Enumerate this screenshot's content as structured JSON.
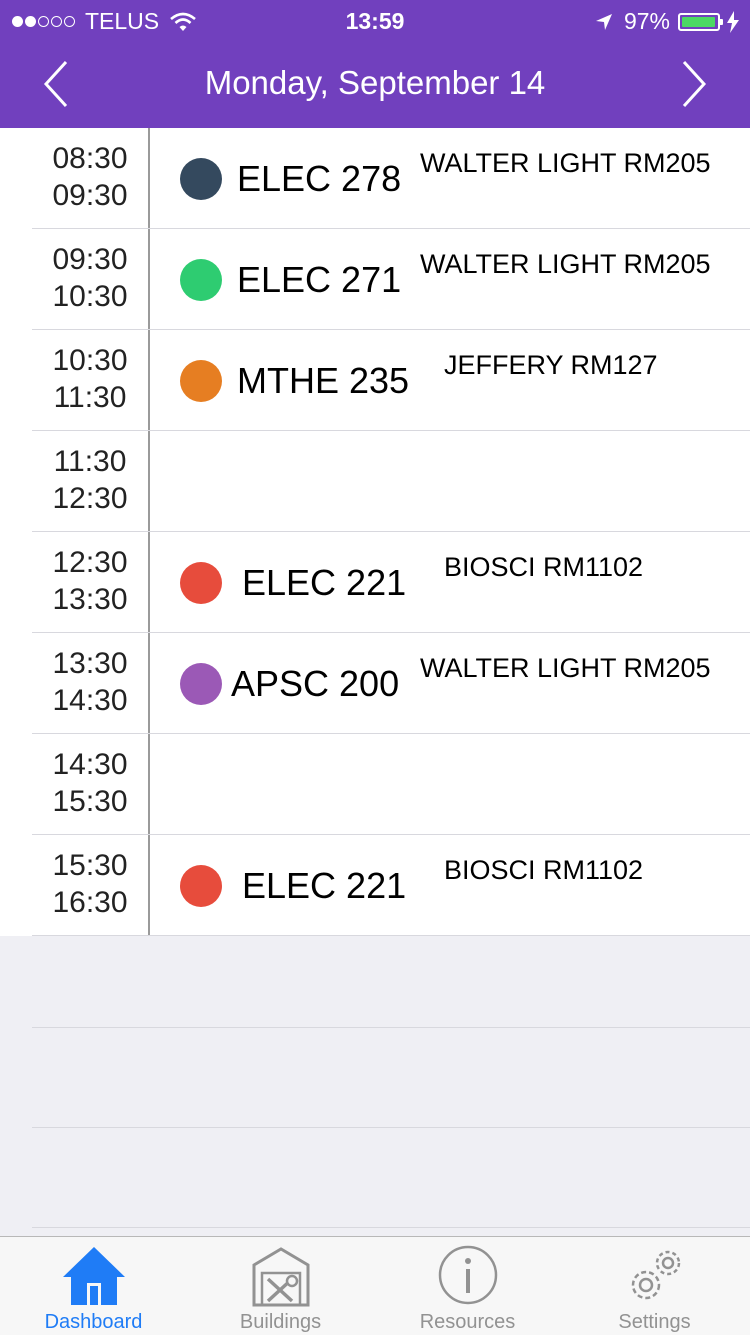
{
  "status_bar": {
    "carrier": "TELUS",
    "signal_full": 2,
    "signal_total": 5,
    "time": "13:59",
    "battery_percent": "97%",
    "battery_level": 0.97
  },
  "nav": {
    "title": "Monday, September 14"
  },
  "schedule": [
    {
      "start": "08:30",
      "end": "09:30",
      "course": "ELEC 278",
      "room": "WALTER LIGHT RM205",
      "color": "#34495e"
    },
    {
      "start": "09:30",
      "end": "10:30",
      "course": "ELEC 271",
      "room": "WALTER LIGHT RM205",
      "color": "#2ecc71"
    },
    {
      "start": "10:30",
      "end": "11:30",
      "course": "MTHE 235",
      "room": "JEFFERY RM127",
      "color": "#e67e22"
    },
    {
      "start": "11:30",
      "end": "12:30",
      "course": "",
      "room": "",
      "color": ""
    },
    {
      "start": "12:30",
      "end": "13:30",
      "course": "ELEC 221",
      "room": "BIOSCI RM1102",
      "color": "#e74c3c"
    },
    {
      "start": "13:30",
      "end": "14:30",
      "course": "APSC 200",
      "room": "WALTER LIGHT RM205",
      "color": "#9b59b6"
    },
    {
      "start": "14:30",
      "end": "15:30",
      "course": "",
      "room": "",
      "color": ""
    },
    {
      "start": "15:30",
      "end": "16:30",
      "course": "ELEC 221",
      "room": "BIOSCI RM1102",
      "color": "#e74c3c"
    }
  ],
  "tabs": [
    {
      "label": "Dashboard",
      "icon": "home-icon",
      "active": true
    },
    {
      "label": "Buildings",
      "icon": "building-icon",
      "active": false
    },
    {
      "label": "Resources",
      "icon": "info-icon",
      "active": false
    },
    {
      "label": "Settings",
      "icon": "gears-icon",
      "active": false
    }
  ],
  "colors": {
    "nav_background": "#7140be",
    "active_tab": "#1f7cf6",
    "battery_fill": "#4cd964"
  }
}
